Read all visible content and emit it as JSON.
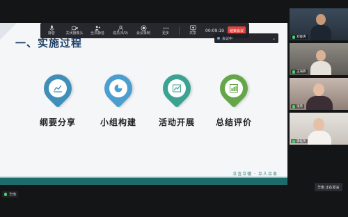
{
  "slide": {
    "title": "一、实施过程",
    "items": [
      {
        "label": "纲要分享",
        "icon": "line-chart-icon",
        "color": "#3f8fb8"
      },
      {
        "label": "小组构建",
        "icon": "pie-chart-icon",
        "color": "#4c9ed1"
      },
      {
        "label": "活动开展",
        "icon": "area-chart-icon",
        "color": "#3aa392"
      },
      {
        "label": "总结评价",
        "icon": "bar-chart-icon",
        "color": "#66a64a"
      }
    ],
    "footer_slogan": "立言立德 · 立人立本"
  },
  "toolbar": {
    "buttons": [
      {
        "label": "静音",
        "icon": "microphone-icon"
      },
      {
        "label": "关闭摄像头",
        "icon": "camera-icon"
      },
      {
        "label": "全员静音",
        "icon": "mute-all-icon"
      },
      {
        "label": "成员(9/9)",
        "icon": "members-icon"
      },
      {
        "label": "会议录制",
        "icon": "record-icon"
      },
      {
        "label": "更多",
        "icon": "more-icon"
      },
      {
        "label": "共享",
        "icon": "share-screen-icon"
      }
    ],
    "timer": "00:09:19",
    "end_label": "结束会议"
  },
  "meeting_chip": {
    "label": "会议中"
  },
  "participants": [
    {
      "name": "刘俊清"
    },
    {
      "name": "王海燕"
    },
    {
      "name": "张燕"
    },
    {
      "name": "李桂英"
    }
  ],
  "self_name": "华南",
  "speaking_text": "华南  正在发言"
}
